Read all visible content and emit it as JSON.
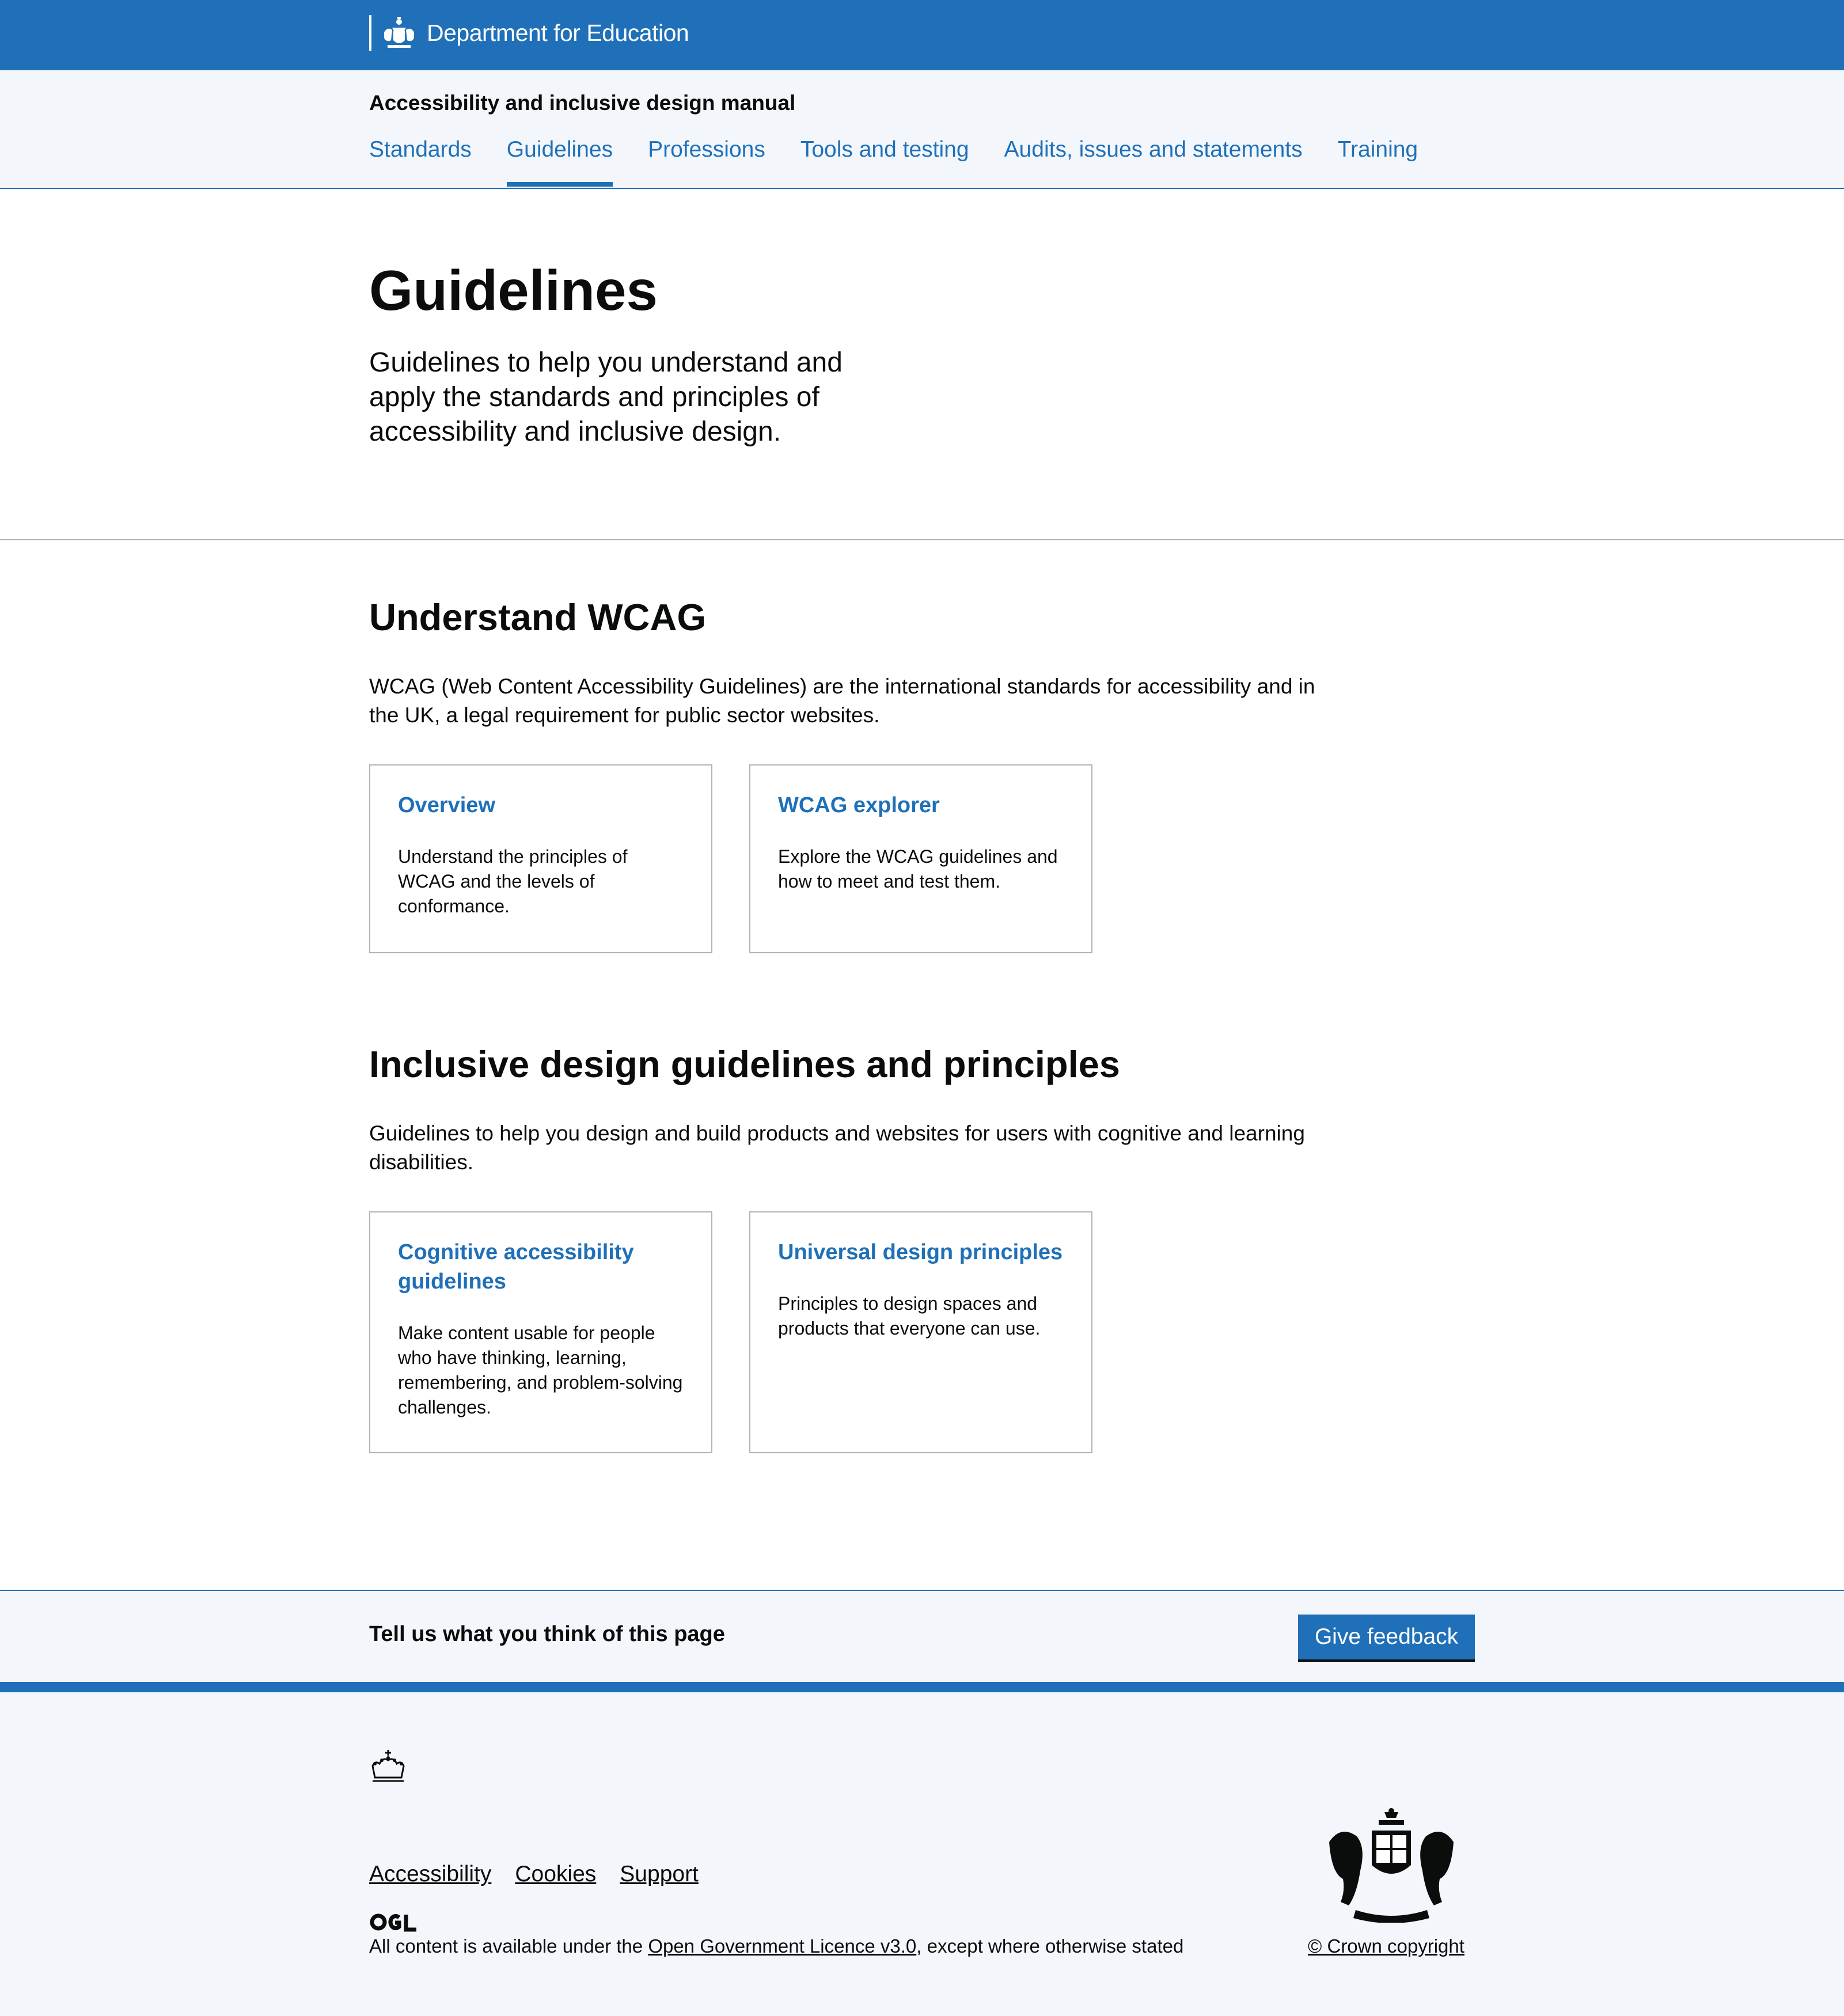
{
  "header": {
    "brand_name": "Department for Education",
    "brand_color": "#1f70b8"
  },
  "service": {
    "name": "Accessibility and inclusive design manual",
    "nav": [
      {
        "label": "Standards",
        "active": false
      },
      {
        "label": "Guidelines",
        "active": true
      },
      {
        "label": "Professions",
        "active": false
      },
      {
        "label": "Tools and testing",
        "active": false
      },
      {
        "label": "Audits, issues and statements",
        "active": false
      },
      {
        "label": "Training",
        "active": false
      }
    ]
  },
  "hero": {
    "title": "Guidelines",
    "lead": "Guidelines to help you understand and apply the standards and principles of accessibility and inclusive design."
  },
  "sections": [
    {
      "title": "Understand WCAG",
      "body": "WCAG (Web Content Accessibility Guidelines) are the international standards for accessibility and in the UK, a legal requirement for public sector websites.",
      "cards": [
        {
          "title": "Overview",
          "text": "Understand the principles of WCAG and the levels of conformance."
        },
        {
          "title": "WCAG explorer",
          "text": "Explore the WCAG guidelines and how to meet and test them."
        }
      ]
    },
    {
      "title": "Inclusive design guidelines and principles",
      "body": "Guidelines to help you design and build products and websites for users with cognitive and learning disabilities.",
      "cards": [
        {
          "title": "Cognitive accessibility guidelines",
          "text": "Make content usable for people who have thinking, learning, remembering, and problem-solving challenges."
        },
        {
          "title": "Universal design principles",
          "text": "Principles to design spaces and products that everyone can use."
        }
      ]
    }
  ],
  "feedback": {
    "text": "Tell us what you think of this page",
    "button": "Give feedback"
  },
  "footer": {
    "links": [
      "Accessibility",
      "Cookies",
      "Support"
    ],
    "ogl_logo": "OGL",
    "licence_prefix": "All content is available under the ",
    "licence_link": "Open Government Licence v3.0",
    "licence_suffix": ", except where otherwise stated",
    "copyright": "© Crown copyright"
  }
}
